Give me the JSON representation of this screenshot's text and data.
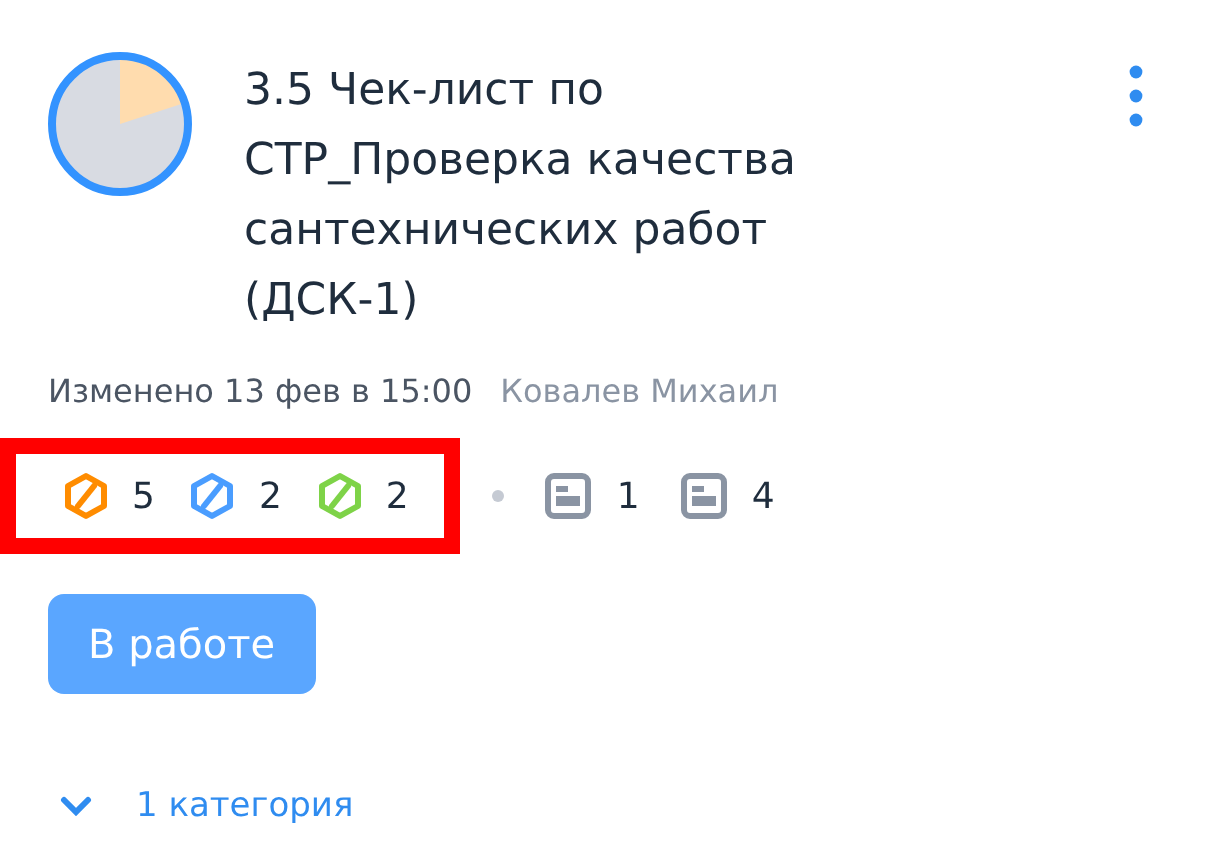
{
  "checklist": {
    "title": "3.5 Чек-лист по СТР_Проверка качества сантехнических работ (ДСК-1)",
    "modified": "Изменено 13 фев в 15:00",
    "author": "Ковалев Михаил"
  },
  "status_counts": {
    "highlighted": true,
    "items": [
      {
        "color": "#ff8c00",
        "count": "5"
      },
      {
        "color": "#4a9dff",
        "count": "2"
      },
      {
        "color": "#7ed348",
        "count": "2"
      }
    ]
  },
  "doc_counts": [
    {
      "count": "1"
    },
    {
      "count": "4"
    }
  ],
  "status_button": {
    "label": "В работе"
  },
  "categories": {
    "label": "1 категория",
    "expanded": false
  }
}
